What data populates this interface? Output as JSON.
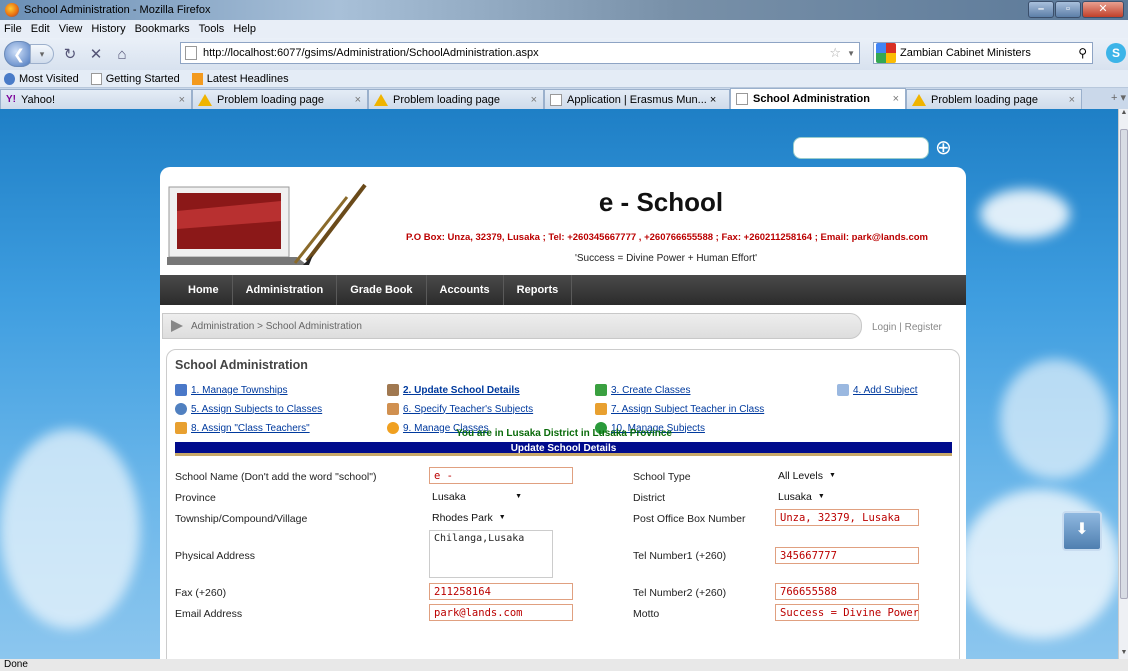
{
  "window": {
    "title": "School Administration - Mozilla Firefox",
    "min": "–",
    "max": "▫",
    "close": "✕"
  },
  "menu": [
    "File",
    "Edit",
    "View",
    "History",
    "Bookmarks",
    "Tools",
    "Help"
  ],
  "nav": {
    "url": "http://localhost:6077/gsims/Administration/SchoolAdministration.aspx",
    "search_value": "Zambian Cabinet Ministers"
  },
  "bookmarks": [
    "Most Visited",
    "Getting Started",
    "Latest Headlines"
  ],
  "tabs": [
    {
      "label": "Yahoo!",
      "icon": "yahoo-icon"
    },
    {
      "label": "Problem loading page",
      "icon": "warning-icon"
    },
    {
      "label": "Problem loading page",
      "icon": "warning-icon"
    },
    {
      "label": "Application | Erasmus Mun... ×",
      "icon": "page-icon"
    },
    {
      "label": "School Administration",
      "icon": "page-icon",
      "active": true
    },
    {
      "label": "Problem loading page",
      "icon": "warning-icon"
    }
  ],
  "site": {
    "name": "e - School",
    "contact": "P.O Box: Unza, 32379, Lusaka ; Tel: +260345667777 , +260766655588 ; Fax: +260211258164 ; Email: park@lands.com",
    "motto": "'Success = Divine Power + Human Effort'",
    "nav": [
      "Home",
      "Administration",
      "Grade Book",
      "Accounts",
      "Reports"
    ],
    "breadcrumb": "Administration  >  School Administration",
    "auth": "Login  |  Register"
  },
  "panel": {
    "title": "School Administration",
    "links": [
      "1. Manage Townships",
      "2. Update School Details",
      "3. Create Classes",
      "4. Add Subject",
      "5. Assign Subjects to Classes",
      "6. Specify Teacher's Subjects",
      "7. Assign Subject Teacher in Class",
      "8. Assign \"Class Teachers\"",
      "9. Manage Classes",
      "10. Manage Subjects"
    ],
    "location": "You are in Lusaka District in Lusaka Province",
    "form_title": "Update School Details"
  },
  "form": {
    "school_name_label": "School Name (Don't add the word \"school\")",
    "school_name": "e -",
    "school_type_label": "School Type",
    "school_type": "All Levels",
    "province_label": "Province",
    "province": "Lusaka",
    "district_label": "District",
    "district": "Lusaka",
    "township_label": "Township/Compound/Village",
    "township": "Rhodes Park",
    "pobox_label": "Post Office Box Number",
    "pobox": "Unza, 32379, Lusaka",
    "address_label": "Physical Address",
    "address": "Chilanga,Lusaka",
    "tel1_label": "Tel Number1 (+260)",
    "tel1": "345667777",
    "fax_label": "Fax (+260)",
    "fax": "211258164",
    "tel2_label": "Tel Number2 (+260)",
    "tel2": "766655588",
    "email_label": "Email Address",
    "email": "park@lands.com",
    "motto_label": "Motto",
    "motto": "Success = Divine Power"
  },
  "status": "Done"
}
